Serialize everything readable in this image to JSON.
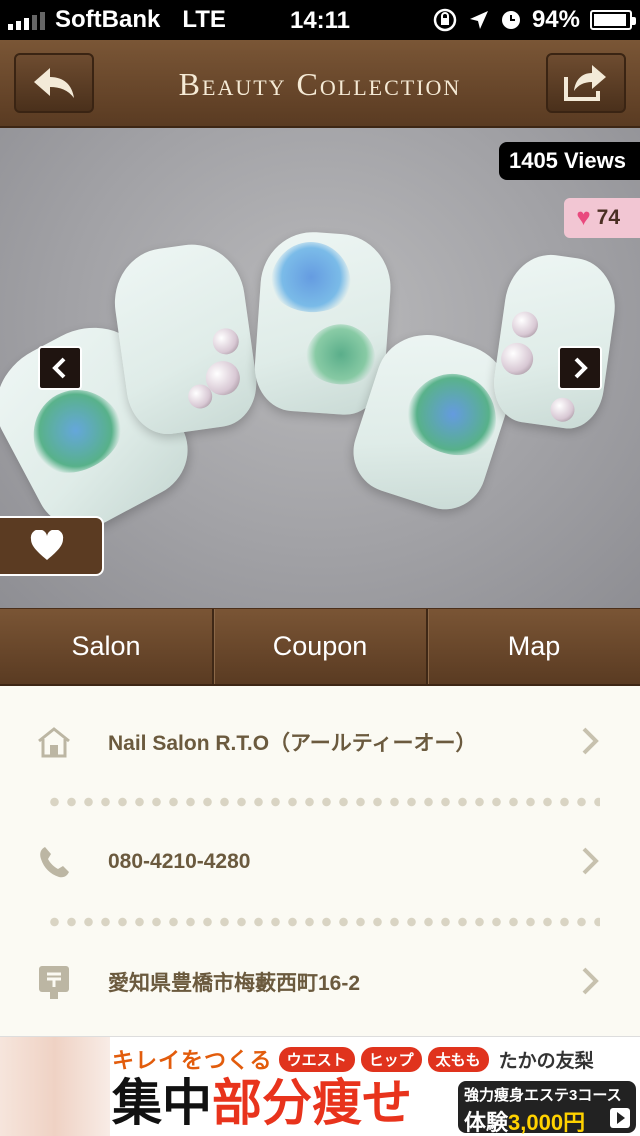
{
  "status_bar": {
    "carrier": "SoftBank",
    "network": "LTE",
    "time": "14:11",
    "battery": "94%",
    "battery_level": 0.94
  },
  "header": {
    "title": "Beauty Collection",
    "back_icon": "back-arrow-icon",
    "share_icon": "share-icon"
  },
  "photo": {
    "views": "1405 Views",
    "likes": "74",
    "prev_icon": "chevron-left-icon",
    "next_icon": "chevron-right-icon",
    "favorite_icon": "heart-icon"
  },
  "tabs": [
    {
      "label": "Salon"
    },
    {
      "label": "Coupon"
    },
    {
      "label": "Map"
    }
  ],
  "info": {
    "salon_name": "Nail Salon R.T.O（アールティーオー）",
    "phone": "080-4210-4280",
    "address": "愛知県豊橋市梅藪西町16-2"
  },
  "ad": {
    "tagline": "キレイをつくる",
    "pills": [
      "ウエスト",
      "ヒップ",
      "太もも"
    ],
    "brand": "たかの友梨",
    "headline_black": "集中",
    "headline_red": "部分痩せ",
    "course": "強力痩身エステ3コース",
    "trial": "体験",
    "price": "3,000円"
  },
  "colors": {
    "brown": "#5a3b22",
    "text_brown": "#6b5a3e",
    "like_pink": "#f2c6d3",
    "heart": "#e94a7e"
  }
}
